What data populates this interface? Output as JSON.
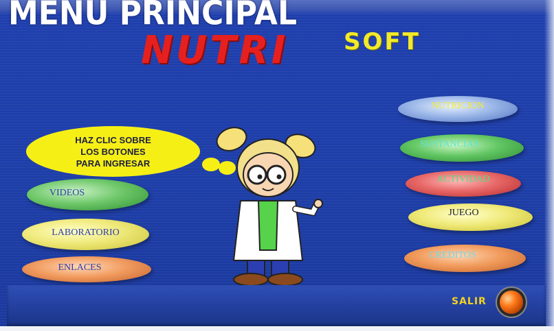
{
  "header": {
    "title": "MENU PRINCIPAL",
    "brand_main": "NUTRI",
    "brand_sub": "SOFT"
  },
  "speech_bubble": {
    "line1": "HAZ CLIC SOBRE",
    "line2": "LOS BOTONES",
    "line3": "PARA INGRESAR"
  },
  "left_buttons": {
    "videos": "VIDEOS",
    "laboratorio": "LABORATORIO",
    "enlaces": "ENLACES"
  },
  "right_buttons": {
    "nutricion": "NUTRICION",
    "sustancias": "SUSTANCIAS",
    "actividad": "ACTIVIDAD",
    "juego": "JUEGO",
    "creditos": "CREDITOS"
  },
  "footer": {
    "exit_label": "SALIR"
  },
  "colors": {
    "background": "#1f3fae",
    "title": "#ffffff",
    "brand_main": "#e6201e",
    "brand_sub": "#f3ea2a",
    "bubble": "#f6ef16",
    "exit_label": "#f3d21f"
  }
}
